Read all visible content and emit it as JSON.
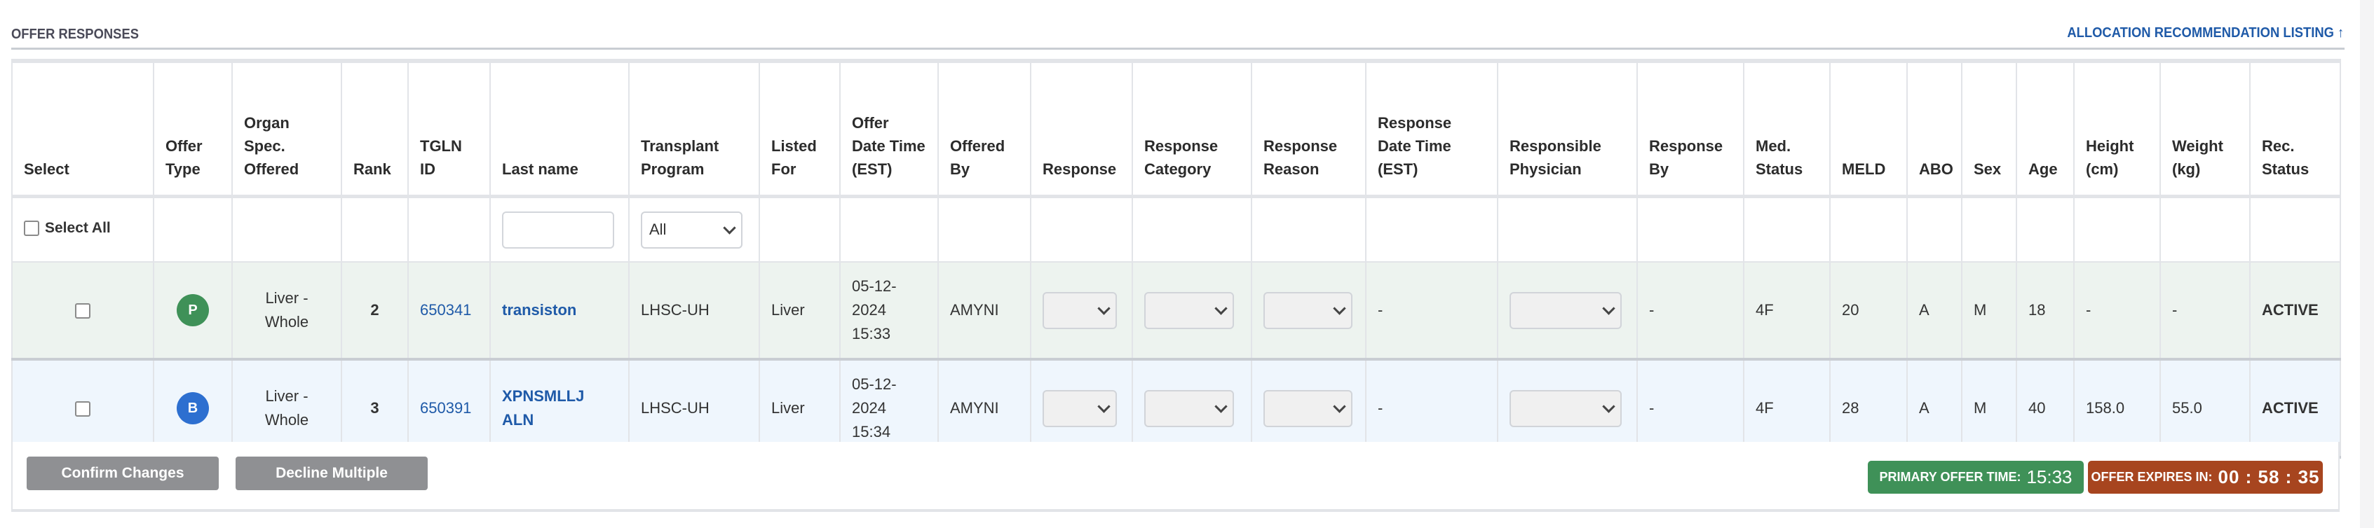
{
  "section": {
    "title": "OFFER RESPONSES",
    "link_label": "ALLOCATION RECOMMENDATION LISTING",
    "link_icon": "arrow-up-icon"
  },
  "columns": [
    "Select",
    "Offer Type",
    "Organ Spec. Offered",
    "Rank",
    "TGLN ID",
    "Last name",
    "Transplant Program",
    "Listed For",
    "Offer Date Time (EST)",
    "Offered By",
    "Response",
    "Response Category",
    "Response Reason",
    "Response Date Time (EST)",
    "Responsible Physician",
    "Response By",
    "Med. Status",
    "MELD",
    "ABO",
    "Sex",
    "Age",
    "Height (cm)",
    "Weight (kg)",
    "Rec. Status"
  ],
  "filters": {
    "select_all_label": "Select All",
    "last_name_value": "",
    "transplant_program_value": "All"
  },
  "rows": [
    {
      "selected": false,
      "offer_type": "P",
      "offer_type_color": "#3f9158",
      "organ_line1": "Liver -",
      "organ_line2": "Whole",
      "rank": "2",
      "tgln_id": "650341",
      "last_name_line1": "transiston",
      "last_name_line2": "",
      "transplant_program": "LHSC-UH",
      "listed_for": "Liver",
      "offer_date_line1": "05-12-",
      "offer_date_line2": "2024",
      "offer_date_line3": "15:33",
      "offered_by": "AMYNI",
      "response": "",
      "response_category": "",
      "response_reason": "",
      "response_date_time": "-",
      "responsible_physician": "",
      "response_by": "-",
      "med_status": "4F",
      "meld": "20",
      "abo": "A",
      "sex": "M",
      "age": "18",
      "height": "-",
      "weight": "-",
      "rec_status": "ACTIVE"
    },
    {
      "selected": false,
      "offer_type": "B",
      "offer_type_color": "#2d6fd0",
      "organ_line1": "Liver -",
      "organ_line2": "Whole",
      "rank": "3",
      "tgln_id": "650391",
      "last_name_line1": "XPNSMLLJ",
      "last_name_line2": "ALN",
      "transplant_program": "LHSC-UH",
      "listed_for": "Liver",
      "offer_date_line1": "05-12-",
      "offer_date_line2": "2024",
      "offer_date_line3": "15:34",
      "offered_by": "AMYNI",
      "response": "",
      "response_category": "",
      "response_reason": "",
      "response_date_time": "-",
      "responsible_physician": "",
      "response_by": "-",
      "med_status": "4F",
      "meld": "28",
      "abo": "A",
      "sex": "M",
      "age": "40",
      "height": "158.0",
      "weight": "55.0",
      "rec_status": "ACTIVE"
    }
  ],
  "footer": {
    "confirm_label": "Confirm Changes",
    "decline_label": "Decline Multiple",
    "primary_offer_label": "PRIMARY OFFER TIME:",
    "primary_offer_value": "15:33",
    "expires_label": "OFFER EXPIRES IN:",
    "expires_value": "00 : 58 : 35"
  },
  "colors": {
    "primary_green": "#3f9158",
    "backup_blue": "#2d6fd0",
    "expire_red": "#a7451f",
    "link_blue": "#1f5aa8",
    "button_gray": "#8f9093"
  }
}
